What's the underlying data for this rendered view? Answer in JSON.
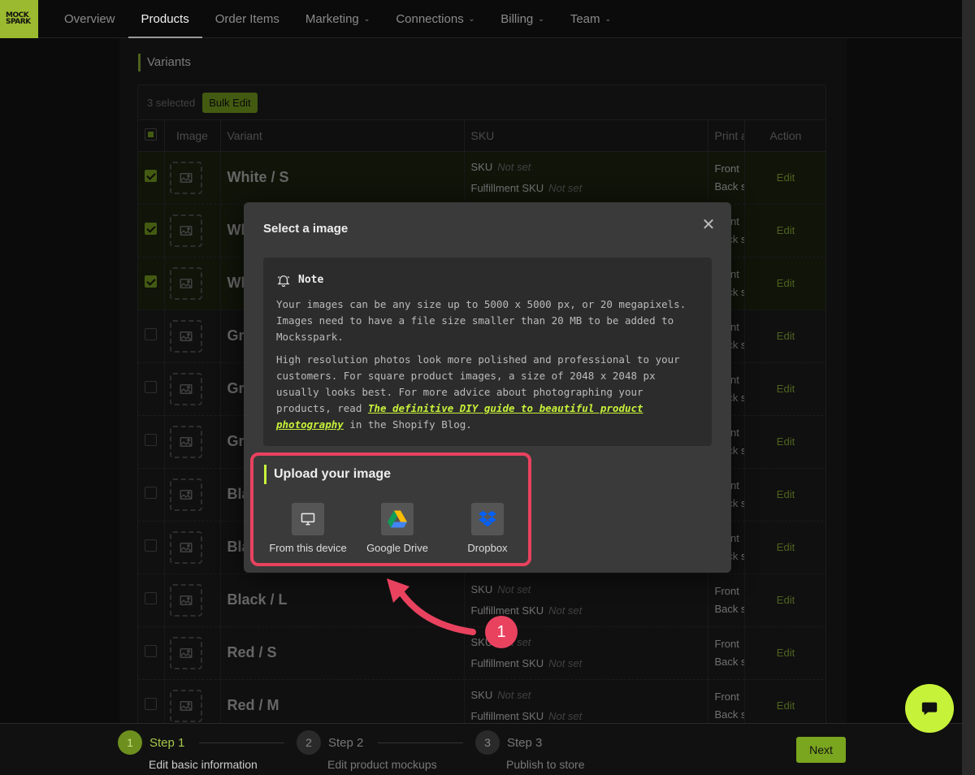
{
  "logo": {
    "text_line1": "MOCK",
    "text_line2": "SPARK"
  },
  "nav": [
    {
      "label": "Overview",
      "dropdown": false,
      "active": false
    },
    {
      "label": "Products",
      "dropdown": false,
      "active": true
    },
    {
      "label": "Order Items",
      "dropdown": false,
      "active": false
    },
    {
      "label": "Marketing",
      "dropdown": true,
      "active": false
    },
    {
      "label": "Connections",
      "dropdown": true,
      "active": false
    },
    {
      "label": "Billing",
      "dropdown": true,
      "active": false
    },
    {
      "label": "Team",
      "dropdown": true,
      "active": false
    }
  ],
  "variants": {
    "title": "Variants",
    "selected_text": "3 selected",
    "bulk_edit_label": "Bulk Edit",
    "columns": {
      "image": "Image",
      "variant": "Variant",
      "sku": "SKU",
      "print": "Print a",
      "action": "Action"
    },
    "sku_label": "SKU",
    "fulfillment_label": "Fulfillment SKU",
    "not_set": "Not set",
    "print_front": "Front",
    "print_back": "Back s",
    "edit_label": "Edit",
    "rows": [
      {
        "name": "White / S",
        "checked": true
      },
      {
        "name": "Wh",
        "checked": true
      },
      {
        "name": "Wh",
        "checked": true
      },
      {
        "name": "Gre",
        "checked": false
      },
      {
        "name": "Gre",
        "checked": false
      },
      {
        "name": "Gre",
        "checked": false
      },
      {
        "name": "Bla",
        "checked": false
      },
      {
        "name": "Bla",
        "checked": false
      },
      {
        "name": "Black / L",
        "checked": false
      },
      {
        "name": "Red / S",
        "checked": false
      },
      {
        "name": "Red / M",
        "checked": false
      }
    ]
  },
  "modal": {
    "title": "Select a image",
    "note_title": "Note",
    "note_p1": "Your images can be any size up to 5000 x 5000 px, or 20 megapixels. Images need to have a file size smaller than 20 MB to be added to Mocksspark.",
    "note_p2_pre": "High resolution photos look more polished and professional to your customers. For square product images, a size of 2048 x 2048 px usually looks best. For more advice about photographing your products, read ",
    "note_link": "The definitive DIY guide to beautiful product photography",
    "note_p2_post": " in the Shopify Blog.",
    "upload_title": "Upload your image",
    "upload_options": [
      {
        "label": "From this device",
        "icon": "monitor-icon"
      },
      {
        "label": "Google Drive",
        "icon": "google-drive-icon"
      },
      {
        "label": "Dropbox",
        "icon": "dropbox-icon"
      }
    ]
  },
  "annotation": {
    "number": "1",
    "color": "#e8425f"
  },
  "steps": [
    {
      "num": "1",
      "label": "Step 1",
      "sub": "Edit basic information",
      "active": true
    },
    {
      "num": "2",
      "label": "Step 2",
      "sub": "Edit product mockups",
      "active": false
    },
    {
      "num": "3",
      "label": "Step 3",
      "sub": "Publish to store",
      "active": false
    }
  ],
  "next_label": "Next",
  "colors": {
    "accent": "#7aa51f",
    "highlight": "#c7f23a",
    "annotation": "#e8425f"
  }
}
